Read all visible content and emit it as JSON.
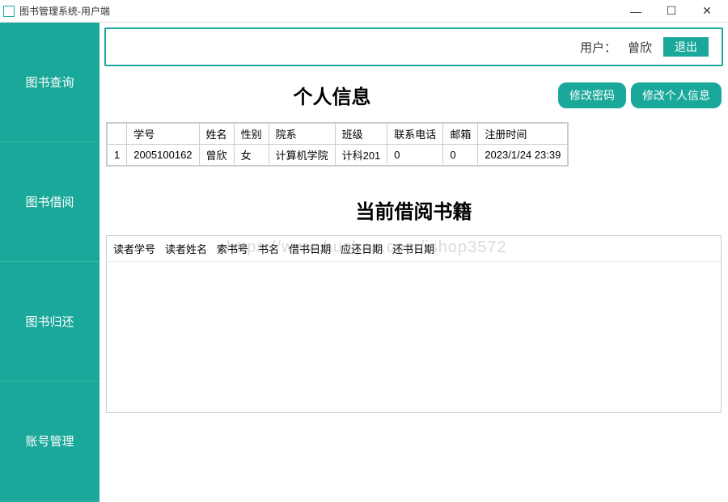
{
  "window": {
    "title": "图书管理系统-用户端"
  },
  "sidebar": {
    "items": [
      {
        "label": "图书查询"
      },
      {
        "label": "图书借阅"
      },
      {
        "label": "图书归还"
      },
      {
        "label": "账号管理"
      }
    ]
  },
  "header": {
    "user_label": "用户：",
    "user_name": "曾欣",
    "logout": "退出"
  },
  "personal": {
    "title": "个人信息",
    "change_pwd": "修改密码",
    "edit_info": "修改个人信息",
    "columns": {
      "rownum": "",
      "id": "学号",
      "name": "姓名",
      "gender": "性别",
      "dept": "院系",
      "class": "班级",
      "phone": "联系电话",
      "email": "邮箱",
      "regtime": "注册时间"
    },
    "row": {
      "num": "1",
      "id": "2005100162",
      "name": "曾欣",
      "gender": "女",
      "dept": "计算机学院",
      "class": "计科201",
      "phone": "0",
      "email": "0",
      "regtime": "2023/1/24 23:39"
    }
  },
  "borrow": {
    "title": "当前借阅书籍",
    "columns": {
      "reader_id": "读者学号",
      "reader_name": "读者姓名",
      "book_no": "索书号",
      "book_name": "书名",
      "borrow_date": "借书日期",
      "due_date": "应还日期",
      "return_date": "还书日期"
    }
  },
  "watermark": "https://www.huzhan.com/ishop3572"
}
